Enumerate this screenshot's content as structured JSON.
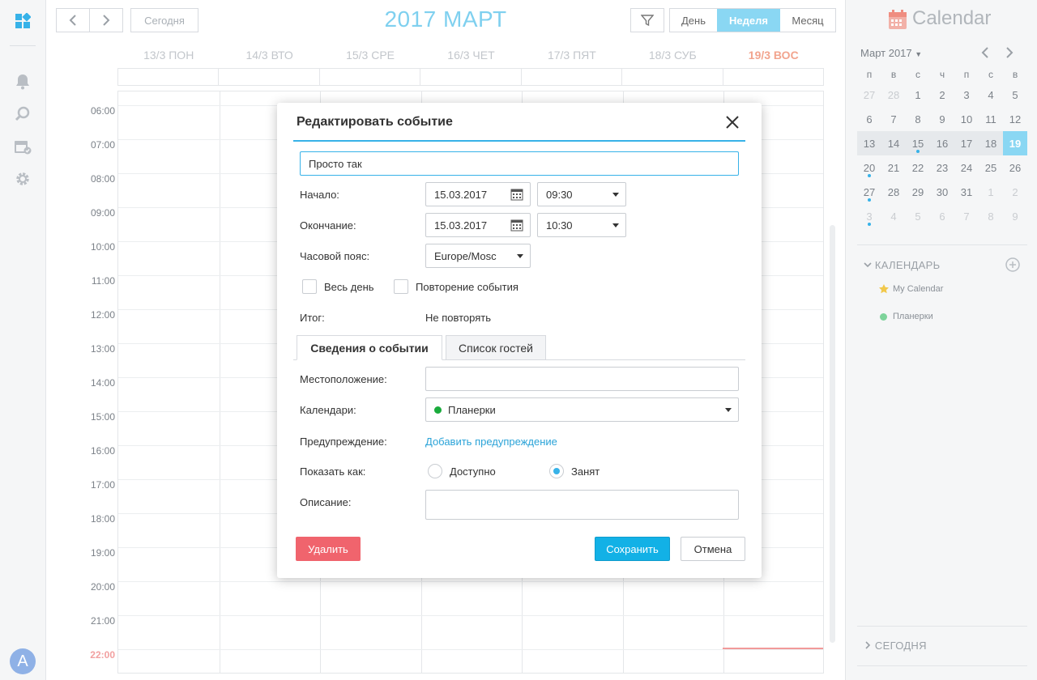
{
  "header": {
    "today_label": "Сегодня",
    "month_title": "2017 МАРТ",
    "views": [
      "День",
      "Неделя",
      "Месяц"
    ],
    "active_view": "Неделя"
  },
  "week": {
    "days": [
      "13/3 ПОН",
      "14/3 ВТО",
      "15/3 СРЕ",
      "16/3 ЧЕТ",
      "17/3 ПЯТ",
      "18/3 СУБ",
      "19/3 ВОС"
    ],
    "today_index": 6,
    "hours": [
      "06:00",
      "07:00",
      "08:00",
      "09:00",
      "10:00",
      "11:00",
      "12:00",
      "13:00",
      "14:00",
      "15:00",
      "16:00",
      "17:00",
      "18:00",
      "19:00",
      "20:00",
      "21:00",
      "22:00"
    ],
    "current_hour": "22:00"
  },
  "sidebar": {
    "title": "Calendar",
    "month_label": "Март 2017",
    "dow": [
      "п",
      "в",
      "с",
      "ч",
      "п",
      "с",
      "в"
    ],
    "weeks": [
      [
        "27",
        "28",
        "1",
        "2",
        "3",
        "4",
        "5"
      ],
      [
        "6",
        "7",
        "8",
        "9",
        "10",
        "11",
        "12"
      ],
      [
        "13",
        "14",
        "15",
        "16",
        "17",
        "18",
        "19"
      ],
      [
        "20",
        "21",
        "22",
        "23",
        "24",
        "25",
        "26"
      ],
      [
        "27",
        "28",
        "29",
        "30",
        "31",
        "1",
        "2"
      ],
      [
        "3",
        "4",
        "5",
        "6",
        "7",
        "8",
        "9"
      ]
    ],
    "calendars_section": "КАЛЕНДАРЬ",
    "calendars": [
      {
        "name": "My Calendar",
        "color": "#f1c84b",
        "icon": "star-icon"
      },
      {
        "name": "Планерки",
        "color": "#7dd39a",
        "icon": "dot-icon"
      }
    ],
    "today_section": "СЕГОДНЯ"
  },
  "modal": {
    "title": "Редактировать событие",
    "event_name": "Просто так",
    "start_label": "Начало:",
    "start_date": "15.03.2017",
    "start_time": "09:30",
    "end_label": "Окончание:",
    "end_date": "15.03.2017",
    "end_time": "10:30",
    "timezone_label": "Часовой пояс:",
    "timezone": "Europe/Mosc",
    "allday_label": "Весь день",
    "repeat_label": "Повторение события",
    "summary_label": "Итог:",
    "summary_value": "Не повторять",
    "tab_details": "Сведения о событии",
    "tab_guests": "Список гостей",
    "location_label": "Местоположение:",
    "location_value": "",
    "calendars_label": "Календари:",
    "calendar_value": "Планерки",
    "calendar_color": "#1aab3c",
    "alert_label": "Предупреждение:",
    "alert_link": "Добавить предупреждение",
    "show_as_label": "Показать как:",
    "show_available": "Доступно",
    "show_busy": "Занят",
    "description_label": "Описание:",
    "description_value": "",
    "delete_label": "Удалить",
    "save_label": "Сохранить",
    "cancel_label": "Отмена"
  },
  "user": {
    "avatar_letter": "A"
  }
}
